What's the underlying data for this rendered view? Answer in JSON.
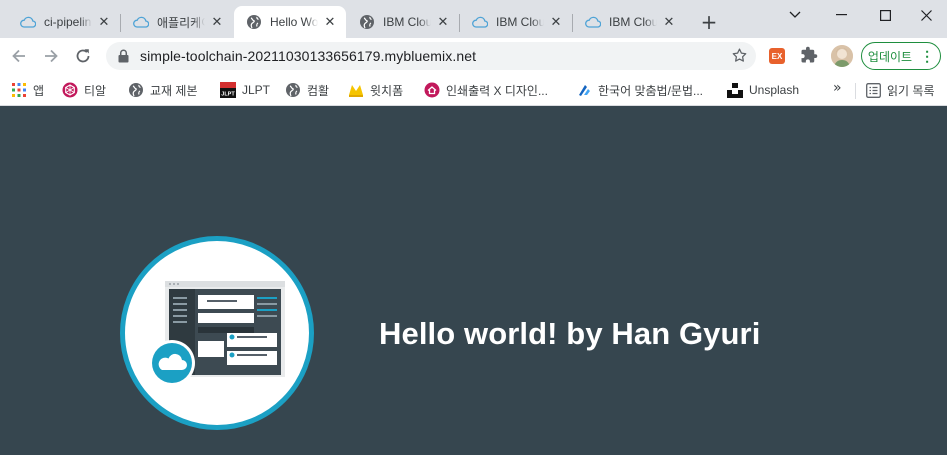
{
  "tabs": [
    {
      "title": "ci-pipeline",
      "icon": "cloud-icon",
      "active": false
    },
    {
      "title": "애플리케이션",
      "icon": "cloud-icon",
      "active": false
    },
    {
      "title": "Hello World",
      "icon": "globe-icon",
      "active": true
    },
    {
      "title": "IBM Cloud",
      "icon": "globe-icon",
      "active": false
    },
    {
      "title": "IBM Cloud",
      "icon": "cloud-icon",
      "active": false
    },
    {
      "title": "IBM Cloud",
      "icon": "cloud-icon",
      "active": false
    }
  ],
  "toolbar": {
    "url": "simple-toolchain-20211030133656179.mybluemix.net",
    "extension_label": "EX",
    "update_label": "업데이트",
    "update_menu": "⋮"
  },
  "bookmarks": {
    "items": [
      {
        "label": "앱",
        "icon": "apps-grid-icon"
      },
      {
        "label": "티알",
        "icon": "polygon-logo-icon"
      },
      {
        "label": "교재 제본",
        "icon": "globe-icon"
      },
      {
        "label": "JLPT",
        "icon": "jlpt-logo-icon"
      },
      {
        "label": "컴활",
        "icon": "globe-icon"
      },
      {
        "label": "윗치폼",
        "icon": "witchform-logo-icon"
      },
      {
        "label": "인쇄출력 X 디자인...",
        "icon": "print-logo-icon"
      },
      {
        "label": "한국어 맞춤법/문법...",
        "icon": "spellcheck-logo-icon"
      },
      {
        "label": "Unsplash",
        "icon": "unsplash-logo-icon"
      }
    ],
    "more": "»",
    "reading_list": "읽기 목록"
  },
  "page": {
    "heading": "Hello world! by Han Gyuri"
  },
  "colors": {
    "page_background": "#36464f",
    "hero_ring": "#1ba0c4",
    "update_green": "#1e8e3e"
  }
}
